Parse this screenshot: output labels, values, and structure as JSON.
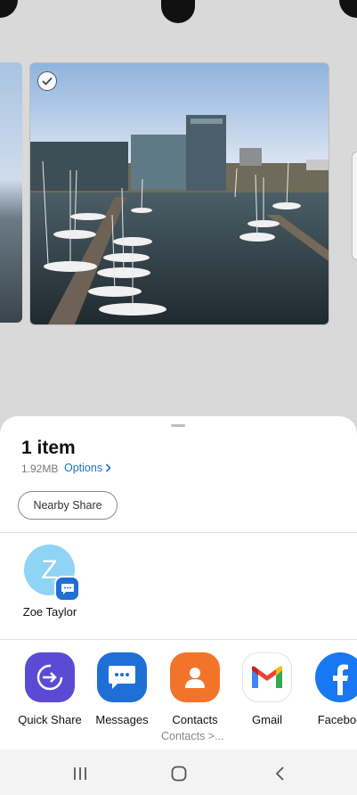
{
  "share_sheet": {
    "title": "1 item",
    "size": "1.92MB",
    "options_label": "Options",
    "nearby_share_label": "Nearby Share"
  },
  "contacts": [
    {
      "name": "Zoe Taylor",
      "initial": "Z"
    }
  ],
  "apps": [
    {
      "label": "Quick Share",
      "icon": "quick-share-icon"
    },
    {
      "label": "Messages",
      "icon": "messages-icon"
    },
    {
      "label": "Contacts",
      "icon": "contacts-icon"
    },
    {
      "label": "Gmail",
      "icon": "gmail-icon"
    },
    {
      "label": "Faceboo",
      "icon": "facebook-icon"
    }
  ],
  "apps_sublabel": "Contacts >...",
  "colors": {
    "accent_link": "#1a73c7",
    "quick_share": "#5b4bd4",
    "messages": "#1f6fd6",
    "contacts": "#f2742b",
    "facebook": "#1877f2"
  }
}
